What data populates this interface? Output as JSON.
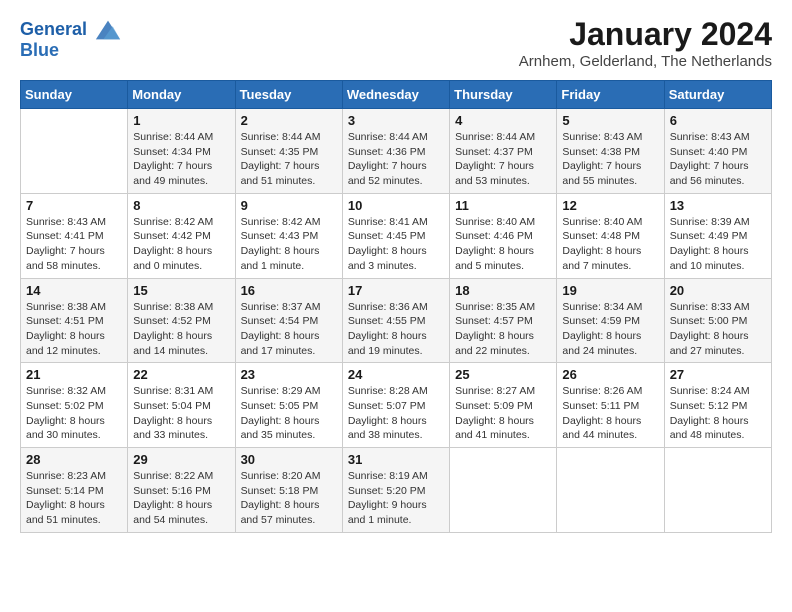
{
  "header": {
    "logo_line1": "General",
    "logo_line2": "Blue",
    "month_year": "January 2024",
    "location": "Arnhem, Gelderland, The Netherlands"
  },
  "weekdays": [
    "Sunday",
    "Monday",
    "Tuesday",
    "Wednesday",
    "Thursday",
    "Friday",
    "Saturday"
  ],
  "weeks": [
    [
      {
        "day": "",
        "sunrise": "",
        "sunset": "",
        "daylight": ""
      },
      {
        "day": "1",
        "sunrise": "Sunrise: 8:44 AM",
        "sunset": "Sunset: 4:34 PM",
        "daylight": "Daylight: 7 hours and 49 minutes."
      },
      {
        "day": "2",
        "sunrise": "Sunrise: 8:44 AM",
        "sunset": "Sunset: 4:35 PM",
        "daylight": "Daylight: 7 hours and 51 minutes."
      },
      {
        "day": "3",
        "sunrise": "Sunrise: 8:44 AM",
        "sunset": "Sunset: 4:36 PM",
        "daylight": "Daylight: 7 hours and 52 minutes."
      },
      {
        "day": "4",
        "sunrise": "Sunrise: 8:44 AM",
        "sunset": "Sunset: 4:37 PM",
        "daylight": "Daylight: 7 hours and 53 minutes."
      },
      {
        "day": "5",
        "sunrise": "Sunrise: 8:43 AM",
        "sunset": "Sunset: 4:38 PM",
        "daylight": "Daylight: 7 hours and 55 minutes."
      },
      {
        "day": "6",
        "sunrise": "Sunrise: 8:43 AM",
        "sunset": "Sunset: 4:40 PM",
        "daylight": "Daylight: 7 hours and 56 minutes."
      }
    ],
    [
      {
        "day": "7",
        "sunrise": "Sunrise: 8:43 AM",
        "sunset": "Sunset: 4:41 PM",
        "daylight": "Daylight: 7 hours and 58 minutes."
      },
      {
        "day": "8",
        "sunrise": "Sunrise: 8:42 AM",
        "sunset": "Sunset: 4:42 PM",
        "daylight": "Daylight: 8 hours and 0 minutes."
      },
      {
        "day": "9",
        "sunrise": "Sunrise: 8:42 AM",
        "sunset": "Sunset: 4:43 PM",
        "daylight": "Daylight: 8 hours and 1 minute."
      },
      {
        "day": "10",
        "sunrise": "Sunrise: 8:41 AM",
        "sunset": "Sunset: 4:45 PM",
        "daylight": "Daylight: 8 hours and 3 minutes."
      },
      {
        "day": "11",
        "sunrise": "Sunrise: 8:40 AM",
        "sunset": "Sunset: 4:46 PM",
        "daylight": "Daylight: 8 hours and 5 minutes."
      },
      {
        "day": "12",
        "sunrise": "Sunrise: 8:40 AM",
        "sunset": "Sunset: 4:48 PM",
        "daylight": "Daylight: 8 hours and 7 minutes."
      },
      {
        "day": "13",
        "sunrise": "Sunrise: 8:39 AM",
        "sunset": "Sunset: 4:49 PM",
        "daylight": "Daylight: 8 hours and 10 minutes."
      }
    ],
    [
      {
        "day": "14",
        "sunrise": "Sunrise: 8:38 AM",
        "sunset": "Sunset: 4:51 PM",
        "daylight": "Daylight: 8 hours and 12 minutes."
      },
      {
        "day": "15",
        "sunrise": "Sunrise: 8:38 AM",
        "sunset": "Sunset: 4:52 PM",
        "daylight": "Daylight: 8 hours and 14 minutes."
      },
      {
        "day": "16",
        "sunrise": "Sunrise: 8:37 AM",
        "sunset": "Sunset: 4:54 PM",
        "daylight": "Daylight: 8 hours and 17 minutes."
      },
      {
        "day": "17",
        "sunrise": "Sunrise: 8:36 AM",
        "sunset": "Sunset: 4:55 PM",
        "daylight": "Daylight: 8 hours and 19 minutes."
      },
      {
        "day": "18",
        "sunrise": "Sunrise: 8:35 AM",
        "sunset": "Sunset: 4:57 PM",
        "daylight": "Daylight: 8 hours and 22 minutes."
      },
      {
        "day": "19",
        "sunrise": "Sunrise: 8:34 AM",
        "sunset": "Sunset: 4:59 PM",
        "daylight": "Daylight: 8 hours and 24 minutes."
      },
      {
        "day": "20",
        "sunrise": "Sunrise: 8:33 AM",
        "sunset": "Sunset: 5:00 PM",
        "daylight": "Daylight: 8 hours and 27 minutes."
      }
    ],
    [
      {
        "day": "21",
        "sunrise": "Sunrise: 8:32 AM",
        "sunset": "Sunset: 5:02 PM",
        "daylight": "Daylight: 8 hours and 30 minutes."
      },
      {
        "day": "22",
        "sunrise": "Sunrise: 8:31 AM",
        "sunset": "Sunset: 5:04 PM",
        "daylight": "Daylight: 8 hours and 33 minutes."
      },
      {
        "day": "23",
        "sunrise": "Sunrise: 8:29 AM",
        "sunset": "Sunset: 5:05 PM",
        "daylight": "Daylight: 8 hours and 35 minutes."
      },
      {
        "day": "24",
        "sunrise": "Sunrise: 8:28 AM",
        "sunset": "Sunset: 5:07 PM",
        "daylight": "Daylight: 8 hours and 38 minutes."
      },
      {
        "day": "25",
        "sunrise": "Sunrise: 8:27 AM",
        "sunset": "Sunset: 5:09 PM",
        "daylight": "Daylight: 8 hours and 41 minutes."
      },
      {
        "day": "26",
        "sunrise": "Sunrise: 8:26 AM",
        "sunset": "Sunset: 5:11 PM",
        "daylight": "Daylight: 8 hours and 44 minutes."
      },
      {
        "day": "27",
        "sunrise": "Sunrise: 8:24 AM",
        "sunset": "Sunset: 5:12 PM",
        "daylight": "Daylight: 8 hours and 48 minutes."
      }
    ],
    [
      {
        "day": "28",
        "sunrise": "Sunrise: 8:23 AM",
        "sunset": "Sunset: 5:14 PM",
        "daylight": "Daylight: 8 hours and 51 minutes."
      },
      {
        "day": "29",
        "sunrise": "Sunrise: 8:22 AM",
        "sunset": "Sunset: 5:16 PM",
        "daylight": "Daylight: 8 hours and 54 minutes."
      },
      {
        "day": "30",
        "sunrise": "Sunrise: 8:20 AM",
        "sunset": "Sunset: 5:18 PM",
        "daylight": "Daylight: 8 hours and 57 minutes."
      },
      {
        "day": "31",
        "sunrise": "Sunrise: 8:19 AM",
        "sunset": "Sunset: 5:20 PM",
        "daylight": "Daylight: 9 hours and 1 minute."
      },
      {
        "day": "",
        "sunrise": "",
        "sunset": "",
        "daylight": ""
      },
      {
        "day": "",
        "sunrise": "",
        "sunset": "",
        "daylight": ""
      },
      {
        "day": "",
        "sunrise": "",
        "sunset": "",
        "daylight": ""
      }
    ]
  ]
}
